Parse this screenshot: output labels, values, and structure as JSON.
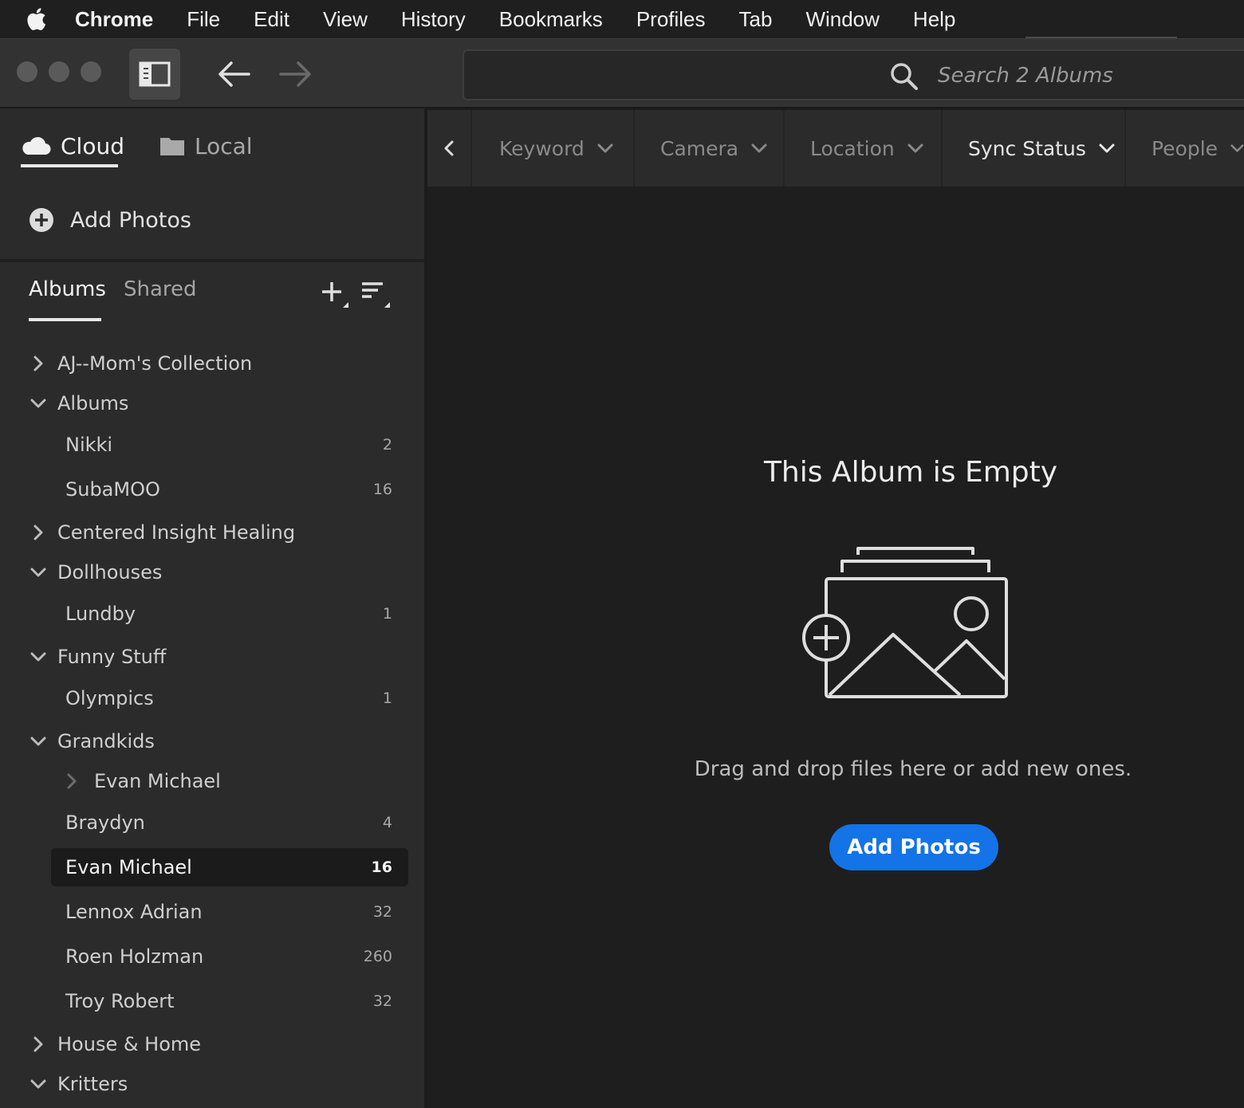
{
  "menubar": {
    "app": "Chrome",
    "items": [
      "File",
      "Edit",
      "View",
      "History",
      "Bookmarks",
      "Profiles",
      "Tab",
      "Window",
      "Help"
    ]
  },
  "toolbar": {
    "search_placeholder": "Search 2 Albums"
  },
  "sidebar": {
    "source_tabs": {
      "cloud": "Cloud",
      "local": "Local"
    },
    "add_photos": "Add Photos",
    "album_tabs": {
      "albums": "Albums",
      "shared": "Shared"
    },
    "tree": [
      {
        "name": "AJ--Mom's Collection",
        "type": "folder",
        "expanded": false,
        "count": ""
      },
      {
        "name": "Albums",
        "type": "folder",
        "expanded": true,
        "count": ""
      },
      {
        "name": "Nikki",
        "type": "album",
        "count": "2"
      },
      {
        "name": "SubaMOO",
        "type": "album",
        "count": "16"
      },
      {
        "name": "Centered Insight Healing",
        "type": "folder",
        "expanded": false,
        "count": ""
      },
      {
        "name": "Dollhouses",
        "type": "folder",
        "expanded": true,
        "count": ""
      },
      {
        "name": "Lundby",
        "type": "album",
        "count": "1"
      },
      {
        "name": "Funny Stuff",
        "type": "folder",
        "expanded": true,
        "count": ""
      },
      {
        "name": "Olympics",
        "type": "album",
        "count": "1"
      },
      {
        "name": "Grandkids",
        "type": "folder",
        "expanded": true,
        "count": ""
      },
      {
        "name": "Evan Michael",
        "type": "subfolder",
        "expanded": false,
        "count": ""
      },
      {
        "name": "Braydyn",
        "type": "album",
        "count": "4"
      },
      {
        "name": "Evan Michael",
        "type": "album",
        "count": "16",
        "selected": true
      },
      {
        "name": "Lennox Adrian",
        "type": "album",
        "count": "32"
      },
      {
        "name": "Roen Holzman",
        "type": "album",
        "count": "260"
      },
      {
        "name": "Troy Robert",
        "type": "album",
        "count": "32"
      },
      {
        "name": "House & Home",
        "type": "folder",
        "expanded": false,
        "count": ""
      },
      {
        "name": "Kritters",
        "type": "folder",
        "expanded": true,
        "count": ""
      }
    ]
  },
  "filters": [
    {
      "label": "Keyword",
      "active": false
    },
    {
      "label": "Camera",
      "active": false
    },
    {
      "label": "Location",
      "active": false
    },
    {
      "label": "Sync Status",
      "active": true
    },
    {
      "label": "People",
      "active": false
    }
  ],
  "main": {
    "empty_title": "This Album is Empty",
    "empty_hint": "Drag and drop files here or add new ones.",
    "add_button": "Add Photos"
  },
  "colors": {
    "accent": "#1473e6",
    "sidebar_bg": "#2b2b2b",
    "main_bg": "#1e1e1e",
    "selected_row_bg": "#1b1b1b"
  }
}
